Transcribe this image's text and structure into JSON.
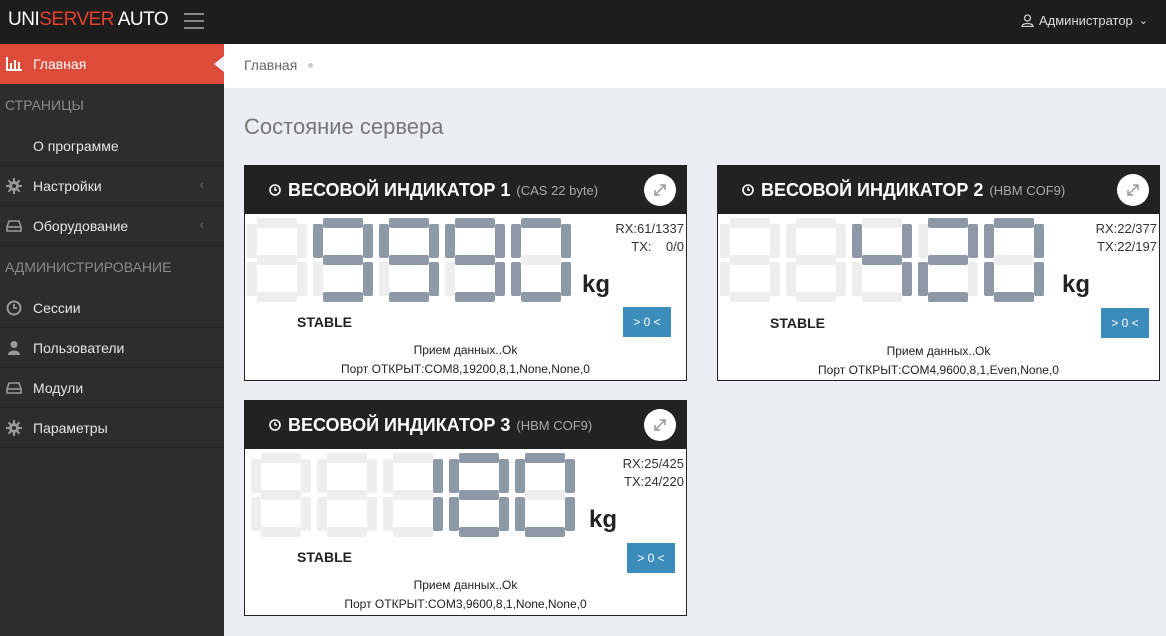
{
  "app": {
    "logo_part1": "UNI",
    "logo_part2": "SERVER",
    "logo_part3": " AUTO",
    "accent": "#dd4b39",
    "user_label": "Администратор"
  },
  "sidebar": {
    "items": [
      {
        "label": "Главная",
        "icon": "bar-chart-icon",
        "active": true
      },
      {
        "section": "СТРАНИЦЫ"
      },
      {
        "label": "О программе"
      },
      {
        "label": "Настройки",
        "icon": "gear-icon",
        "has_children": true
      },
      {
        "label": "Оборудование",
        "icon": "hdd-icon",
        "has_children": true
      },
      {
        "section": "АДМИНИСТРИРОВАНИЕ"
      },
      {
        "label": "Сессии",
        "icon": "clock-icon"
      },
      {
        "label": "Пользователи",
        "icon": "user-icon"
      },
      {
        "label": "Модули",
        "icon": "hdd-icon"
      },
      {
        "label": "Параметры",
        "icon": "gear-icon"
      }
    ]
  },
  "breadcrumb": {
    "current": "Главная"
  },
  "page_title": "Состояние сервера",
  "panels": [
    {
      "title": "ВЕСОВОЙ ИНДИКАТОР 1",
      "subtitle": "(CAS 22 byte)",
      "display": "9990",
      "unit": "kg",
      "rx": "RX:61/1337",
      "tx": "TX:    0/0",
      "state": "STABLE",
      "zero_label": "> 0 <",
      "status_line1": "Прием данных..Ok",
      "status_line2": "Порт ОТКРЫТ:COM8,19200,8,1,None,None,0"
    },
    {
      "title": "ВЕСОВОЙ ИНДИКАТОР 2",
      "subtitle": "(HBM COF9)",
      "display": "420",
      "unit": "kg",
      "rx": "RX:22/377",
      "tx": "TX:22/197",
      "state": "STABLE",
      "zero_label": "> 0 <",
      "status_line1": "Прием данных..Ok",
      "status_line2": "Порт ОТКРЫТ:COM4,9600,8,1,Even,None,0"
    },
    {
      "title": "ВЕСОВОЙ ИНДИКАТОР 3",
      "subtitle": "(HBM COF9)",
      "display": "180",
      "unit": "kg",
      "rx": "RX:25/425",
      "tx": "TX:24/220",
      "state": "STABLE",
      "zero_label": "> 0 <",
      "status_line1": "Прием данных..Ok",
      "status_line2": "Порт ОТКРЫТ:COM3,9600,8,1,None,None,0"
    }
  ]
}
